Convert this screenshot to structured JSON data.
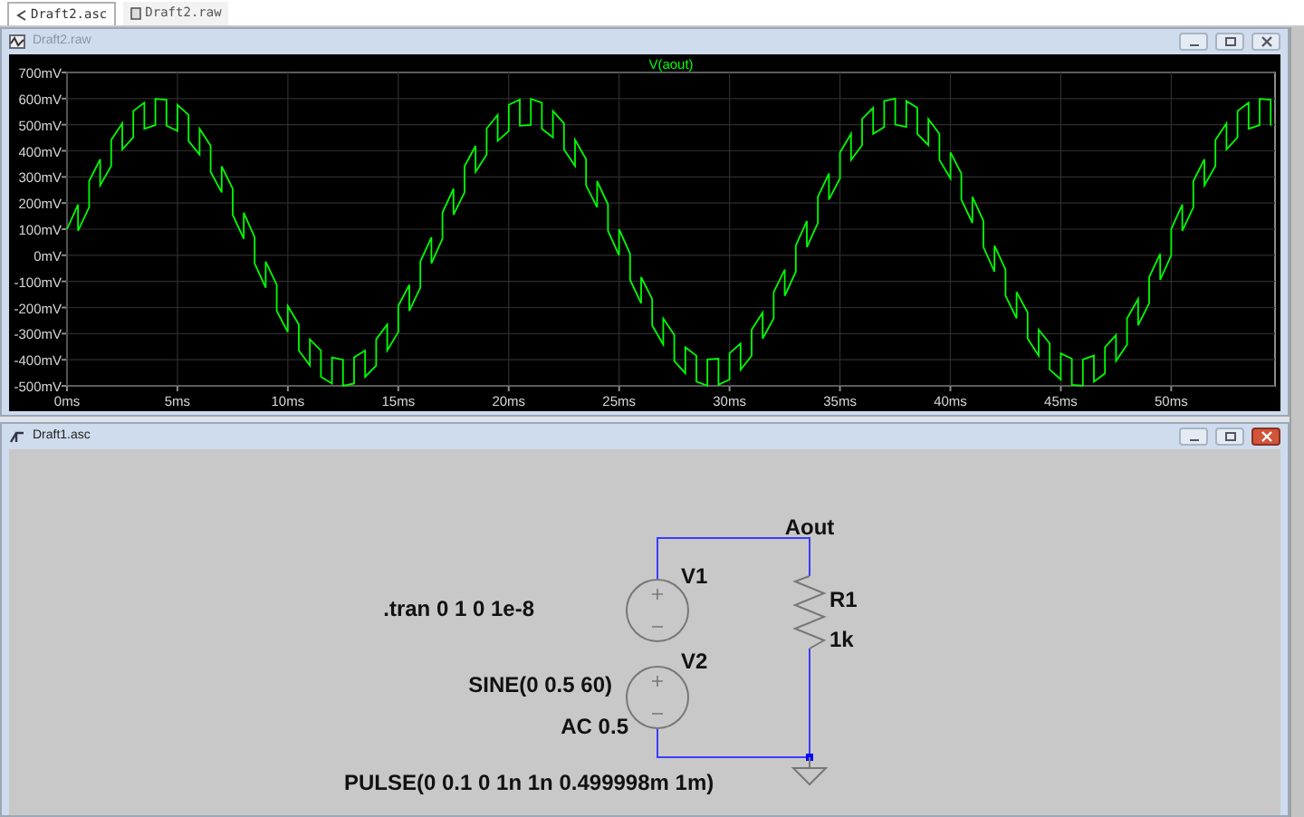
{
  "tabs": [
    {
      "label": "Draft2.asc",
      "selected": true
    },
    {
      "label": "Draft2.raw",
      "selected": false
    }
  ],
  "plot_window": {
    "title": "Draft2.raw",
    "active": false,
    "chart_data": {
      "type": "line",
      "grid": true,
      "xlim": [
        0,
        54.7
      ],
      "ylim": [
        -500,
        700
      ],
      "xticks": [
        {
          "value": 0,
          "label": "0ms"
        },
        {
          "value": 5,
          "label": "5ms"
        },
        {
          "value": 10,
          "label": "10ms"
        },
        {
          "value": 15,
          "label": "15ms"
        },
        {
          "value": 20,
          "label": "20ms"
        },
        {
          "value": 25,
          "label": "25ms"
        },
        {
          "value": 30,
          "label": "30ms"
        },
        {
          "value": 35,
          "label": "35ms"
        },
        {
          "value": 40,
          "label": "40ms"
        },
        {
          "value": 45,
          "label": "45ms"
        },
        {
          "value": 50,
          "label": "50ms"
        }
      ],
      "yticks": [
        {
          "value": 700,
          "label": "700mV"
        },
        {
          "value": 600,
          "label": "600mV"
        },
        {
          "value": 500,
          "label": "500mV"
        },
        {
          "value": 400,
          "label": "400mV"
        },
        {
          "value": 300,
          "label": "300mV"
        },
        {
          "value": 200,
          "label": "200mV"
        },
        {
          "value": 100,
          "label": "100mV"
        },
        {
          "value": 0,
          "label": "0mV"
        },
        {
          "value": -100,
          "label": "-100mV"
        },
        {
          "value": -200,
          "label": "-200mV"
        },
        {
          "value": -300,
          "label": "-300mV"
        },
        {
          "value": -400,
          "label": "-400mV"
        },
        {
          "value": -500,
          "label": "-500mV"
        }
      ],
      "x": [
        0,
        0.5,
        0.5,
        1,
        1,
        1.5,
        1.5,
        2,
        2,
        2.5,
        2.5,
        3,
        3,
        3.5,
        3.5,
        4,
        4,
        4.5,
        4.5,
        5,
        5,
        5.5,
        5.5,
        6,
        6,
        6.5,
        6.5,
        7,
        7,
        7.5,
        7.5,
        8,
        8,
        8.5,
        8.5,
        9,
        9,
        9.5,
        9.5,
        10,
        10,
        10.5,
        10.5,
        11,
        11,
        11.5,
        11.5,
        12,
        12,
        12.5,
        12.5,
        13,
        13,
        13.5,
        13.5,
        14,
        14,
        14.5,
        14.5,
        15,
        15,
        15.5,
        15.5,
        16,
        16,
        16.5,
        16.5,
        17,
        17,
        17.5,
        17.5,
        18,
        18,
        18.5,
        18.5,
        19,
        19,
        19.5,
        19.5,
        20,
        20,
        20.5,
        20.5,
        21,
        21,
        21.5,
        21.5,
        22,
        22,
        22.5,
        22.5,
        23,
        23,
        23.5,
        23.5,
        24,
        24,
        24.5,
        24.5,
        25,
        25,
        25.5,
        25.5,
        26,
        26,
        26.5,
        26.5,
        27,
        27,
        27.5,
        27.5,
        28,
        28,
        28.5,
        28.5,
        29,
        29,
        29.5,
        29.5,
        30,
        30,
        30.5,
        30.5,
        31,
        31,
        31.5,
        31.5,
        32,
        32,
        32.5,
        32.5,
        33,
        33,
        33.5,
        33.5,
        34,
        34,
        34.5,
        34.5,
        35,
        35,
        35.5,
        35.5,
        36,
        36,
        36.5,
        36.5,
        37,
        37,
        37.5,
        37.5,
        38,
        38,
        38.5,
        38.5,
        39,
        39,
        39.5,
        39.5,
        40,
        40,
        40.5,
        40.5,
        41,
        41,
        41.5,
        41.5,
        42,
        42,
        42.5,
        42.5,
        43,
        43,
        43.5,
        43.5,
        44,
        44,
        44.5,
        44.5,
        45,
        45,
        45.5,
        45.5,
        46,
        46,
        46.5,
        46.5,
        47,
        47,
        47.5,
        47.5,
        48,
        48,
        48.5,
        48.5,
        49,
        49,
        49.5,
        49.5,
        50,
        50,
        50.5,
        50.5,
        51,
        51,
        51.5,
        51.5,
        52,
        52,
        52.5,
        52.5,
        53,
        53,
        53.5,
        53.5,
        54,
        54,
        54.5,
        54.5
      ],
      "series": [
        {
          "name": "V(aout)",
          "color": "#00ff00",
          "values": [
            100,
            194,
            94,
            184,
            284,
            368,
            268,
            342,
            442,
            505,
            405,
            452,
            552,
            584,
            484,
            499,
            599,
            596,
            496,
            476,
            576,
            538,
            438,
            385,
            485,
            419,
            319,
            241,
            341,
            255,
            155,
            63,
            163,
            69,
            -31,
            -124,
            -24,
            -113,
            -213,
            -294,
            -194,
            -265,
            -365,
            -422,
            -322,
            -365,
            -465,
            -491,
            -391,
            -400,
            -500,
            -491,
            -391,
            -365,
            -465,
            -422,
            -322,
            -265,
            -365,
            -294,
            -194,
            -113,
            -213,
            -124,
            -24,
            69,
            -31,
            63,
            163,
            255,
            155,
            241,
            341,
            419,
            319,
            385,
            485,
            538,
            438,
            476,
            576,
            596,
            496,
            499,
            599,
            584,
            484,
            452,
            552,
            505,
            405,
            342,
            442,
            368,
            268,
            184,
            284,
            194,
            94,
            0,
            100,
            6,
            -94,
            -184,
            -84,
            -168,
            -268,
            -342,
            -242,
            -305,
            -405,
            -452,
            -352,
            -384,
            -484,
            -499,
            -399,
            -396,
            -496,
            -476,
            -376,
            -338,
            -438,
            -385,
            -285,
            -219,
            -319,
            -241,
            -141,
            -55,
            -155,
            -63,
            37,
            131,
            31,
            124,
            224,
            313,
            213,
            294,
            394,
            465,
            365,
            422,
            522,
            565,
            465,
            491,
            591,
            600,
            500,
            491,
            591,
            565,
            465,
            422,
            522,
            465,
            365,
            294,
            394,
            313,
            213,
            124,
            224,
            131,
            31,
            -63,
            37,
            -55,
            -155,
            -241,
            -141,
            -219,
            -319,
            -385,
            -285,
            -338,
            -438,
            -476,
            -376,
            -396,
            -496,
            -499,
            -399,
            -384,
            -484,
            -452,
            -352,
            -305,
            -405,
            -342,
            -242,
            -168,
            -268,
            -184,
            -84,
            6,
            -94,
            0,
            100,
            194,
            94,
            184,
            284,
            368,
            268,
            342,
            442,
            505,
            405,
            452,
            552,
            584,
            484,
            499,
            599,
            596,
            496
          ]
        }
      ]
    }
  },
  "schematic_window": {
    "title": "Draft1.asc",
    "active": true,
    "net_label": "Aout",
    "components": [
      {
        "kind": "voltage_source",
        "name": "V1"
      },
      {
        "kind": "voltage_source",
        "name": "V2"
      },
      {
        "kind": "resistor",
        "name": "R1",
        "value": "1k"
      }
    ],
    "texts": [
      ".tran 0 1 0 1e-8",
      "SINE(0 0.5 60)",
      "AC 0.5",
      "PULSE(0 0.1 0 1n 1n 0.499998m 1m)"
    ]
  }
}
